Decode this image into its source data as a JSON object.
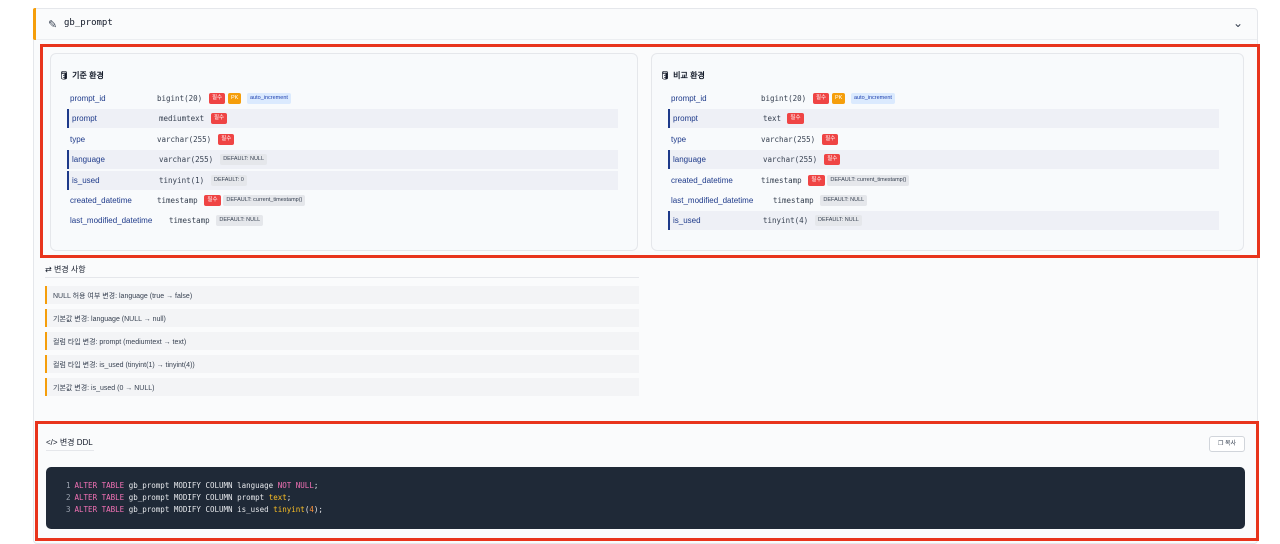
{
  "header": {
    "title": "gb_prompt"
  },
  "base": {
    "title": "기준 환경",
    "rows": [
      {
        "name": "prompt_id",
        "type": "bigint(20)",
        "tags": [
          "필수",
          "PK",
          "auto_increment"
        ]
      },
      {
        "name": "prompt",
        "type": "mediumtext",
        "tags": [
          "필수"
        ]
      },
      {
        "name": "type",
        "type": "varchar(255)",
        "tags": [
          "필수"
        ]
      },
      {
        "name": "language",
        "type": "varchar(255)",
        "tags": [
          "DEFAULT: NULL"
        ]
      },
      {
        "name": "is_used",
        "type": "tinyint(1)",
        "tags": [
          "DEFAULT: 0"
        ]
      },
      {
        "name": "created_datetime",
        "type": "timestamp",
        "tags": [
          "필수",
          "DEFAULT: current_timestamp()"
        ]
      },
      {
        "name": "last_modified_datetime",
        "type": "timestamp",
        "tags": [
          "DEFAULT: NULL"
        ]
      }
    ]
  },
  "compare": {
    "title": "비교 환경",
    "rows": [
      {
        "name": "prompt_id",
        "type": "bigint(20)",
        "tags": [
          "필수",
          "PK",
          "auto_increment"
        ]
      },
      {
        "name": "prompt",
        "type": "text",
        "tags": [
          "필수"
        ]
      },
      {
        "name": "type",
        "type": "varchar(255)",
        "tags": [
          "필수"
        ]
      },
      {
        "name": "language",
        "type": "varchar(255)",
        "tags": [
          "필수"
        ]
      },
      {
        "name": "created_datetime",
        "type": "timestamp",
        "tags": [
          "필수",
          "DEFAULT: current_timestamp()"
        ]
      },
      {
        "name": "last_modified_datetime",
        "type": "timestamp",
        "tags": [
          "DEFAULT: NULL"
        ]
      },
      {
        "name": "is_used",
        "type": "tinyint(4)",
        "tags": [
          "DEFAULT: NULL"
        ]
      }
    ]
  },
  "changes": {
    "title": "변경 사항",
    "items": [
      "NULL 허용 여부 변경: language (true → false)",
      "기본값 변경: language (NULL → null)",
      "컬럼 타입 변경: prompt (mediumtext → text)",
      "컬럼 타입 변경: is_used (tinyint(1) → tinyint(4))",
      "기본값 변경: is_used (0 → NULL)"
    ]
  },
  "ddl": {
    "title": "변경 DDL",
    "copy_label": "복사",
    "line_numbers": [
      "1",
      "2",
      "3"
    ],
    "lines": [
      {
        "kw": "ALTER TABLE",
        "mid": " gb_prompt MODIFY COLUMN language ",
        "val": "NOT NULL",
        "tail": ";"
      },
      {
        "kw": "ALTER TABLE",
        "mid": " gb_prompt MODIFY COLUMN prompt ",
        "val": "text",
        "tail": ";"
      },
      {
        "kw": "ALTER TABLE",
        "mid": " gb_prompt MODIFY COLUMN is_used ",
        "val": "tinyint",
        "num": "4",
        "tail": ";"
      }
    ]
  },
  "colors": {
    "accent": "#f59e0b",
    "required": "#ef4444",
    "highlight_border": "#1e3a8a",
    "annotation": "#e8341c"
  }
}
